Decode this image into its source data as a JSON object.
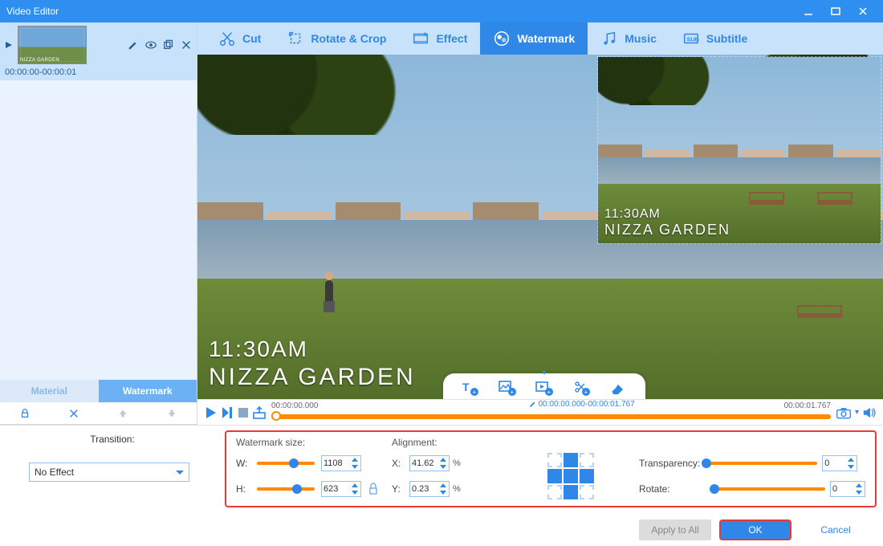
{
  "window": {
    "title": "Video Editor"
  },
  "tabs": {
    "cut": "Cut",
    "rotate": "Rotate & Crop",
    "effect": "Effect",
    "watermark": "Watermark",
    "music": "Music",
    "subtitle": "Subtitle"
  },
  "left": {
    "thumb_label": "NIZZA GARDEN",
    "time_range": "00:00:00-00:00:01",
    "tabs": {
      "material": "Material",
      "watermark": "Watermark"
    }
  },
  "preview": {
    "main_wm_line1": "11:30AM",
    "main_wm_line2": "NIZZA GARDEN",
    "overlay_wm_line1": "11:30AM",
    "overlay_wm_line2": "NIZZA GARDEN"
  },
  "timeline": {
    "start": "00:00:00.000",
    "end": "00:00:01.767",
    "range": "00:00:00.000-00:00:01.767"
  },
  "transition": {
    "label": "Transition:",
    "value": "No Effect"
  },
  "wm_panel": {
    "size_header": "Watermark size:",
    "align_header": "Alignment:",
    "W_label": "W:",
    "H_label": "H:",
    "X_label": "X:",
    "Y_label": "Y:",
    "W": "1108",
    "H": "623",
    "X": "41.62",
    "Y": "0.23",
    "pct": "%",
    "transparency_label": "Transparency:",
    "rotate_label": "Rotate:",
    "transparency": "0",
    "rotate": "0"
  },
  "footer": {
    "apply_all": "Apply to All",
    "ok": "OK",
    "cancel": "Cancel"
  }
}
